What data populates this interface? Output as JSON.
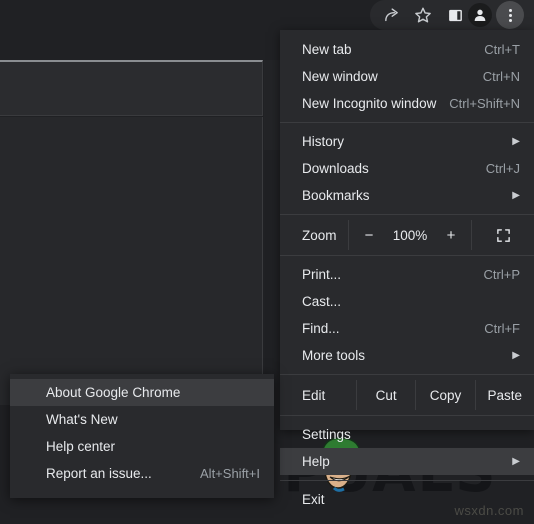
{
  "toolbar": {
    "icons": [
      {
        "name": "share-icon",
        "label": "Share this page"
      },
      {
        "name": "bookmark-star-icon",
        "label": "Bookmark this tab"
      },
      {
        "name": "side-panel-icon",
        "label": "Side panel"
      },
      {
        "name": "profile-avatar-icon",
        "label": "Profile"
      },
      {
        "name": "three-dot-menu-icon",
        "label": "Customize and control Google Chrome"
      }
    ]
  },
  "menu": {
    "sections": [
      {
        "items": [
          {
            "label": "New tab",
            "accel": "Ctrl+T",
            "submenu": false,
            "highlighted": false
          },
          {
            "label": "New window",
            "accel": "Ctrl+N",
            "submenu": false,
            "highlighted": false
          },
          {
            "label": "New Incognito window",
            "accel": "Ctrl+Shift+N",
            "submenu": false,
            "highlighted": false
          }
        ]
      },
      {
        "items": [
          {
            "label": "History",
            "accel": "",
            "submenu": true,
            "highlighted": false
          },
          {
            "label": "Downloads",
            "accel": "Ctrl+J",
            "submenu": false,
            "highlighted": false
          },
          {
            "label": "Bookmarks",
            "accel": "",
            "submenu": true,
            "highlighted": false
          }
        ]
      },
      {
        "items": [
          {
            "label": "Print...",
            "accel": "Ctrl+P",
            "submenu": false,
            "highlighted": false
          },
          {
            "label": "Cast...",
            "accel": "",
            "submenu": false,
            "highlighted": false
          },
          {
            "label": "Find...",
            "accel": "Ctrl+F",
            "submenu": false,
            "highlighted": false
          },
          {
            "label": "More tools",
            "accel": "",
            "submenu": true,
            "highlighted": false
          }
        ]
      },
      {
        "items": [
          {
            "label": "Settings",
            "accel": "",
            "submenu": false,
            "highlighted": false
          },
          {
            "label": "Help",
            "accel": "",
            "submenu": true,
            "highlighted": true
          }
        ]
      },
      {
        "items": [
          {
            "label": "Exit",
            "accel": "",
            "submenu": false,
            "highlighted": false
          }
        ]
      }
    ],
    "zoom_row": {
      "label": "Zoom",
      "minus": "−",
      "value": "100%",
      "plus": "+",
      "fullscreen_icon": "fullscreen-icon"
    },
    "edit_row": {
      "label": "Edit",
      "cut": "Cut",
      "copy": "Copy",
      "paste": "Paste"
    }
  },
  "submenu": {
    "items": [
      {
        "label": "About Google Chrome",
        "accel": "",
        "highlighted": true
      },
      {
        "label": "What's New",
        "accel": "",
        "highlighted": false
      },
      {
        "label": "Help center",
        "accel": "",
        "highlighted": false
      },
      {
        "label": "Report an issue...",
        "accel": "Alt+Shift+I",
        "highlighted": false
      }
    ]
  },
  "watermark": {
    "text_left": "A",
    "text_right": "PUALS",
    "site_credit": "wsxdn.com"
  },
  "colors": {
    "menu_bg": "#292a2d",
    "highlight": "#3c3d40",
    "text": "#e8eaed",
    "accel_text": "#9aa0a6",
    "page_bg": "#202124",
    "divider": "#3b3c3f"
  }
}
